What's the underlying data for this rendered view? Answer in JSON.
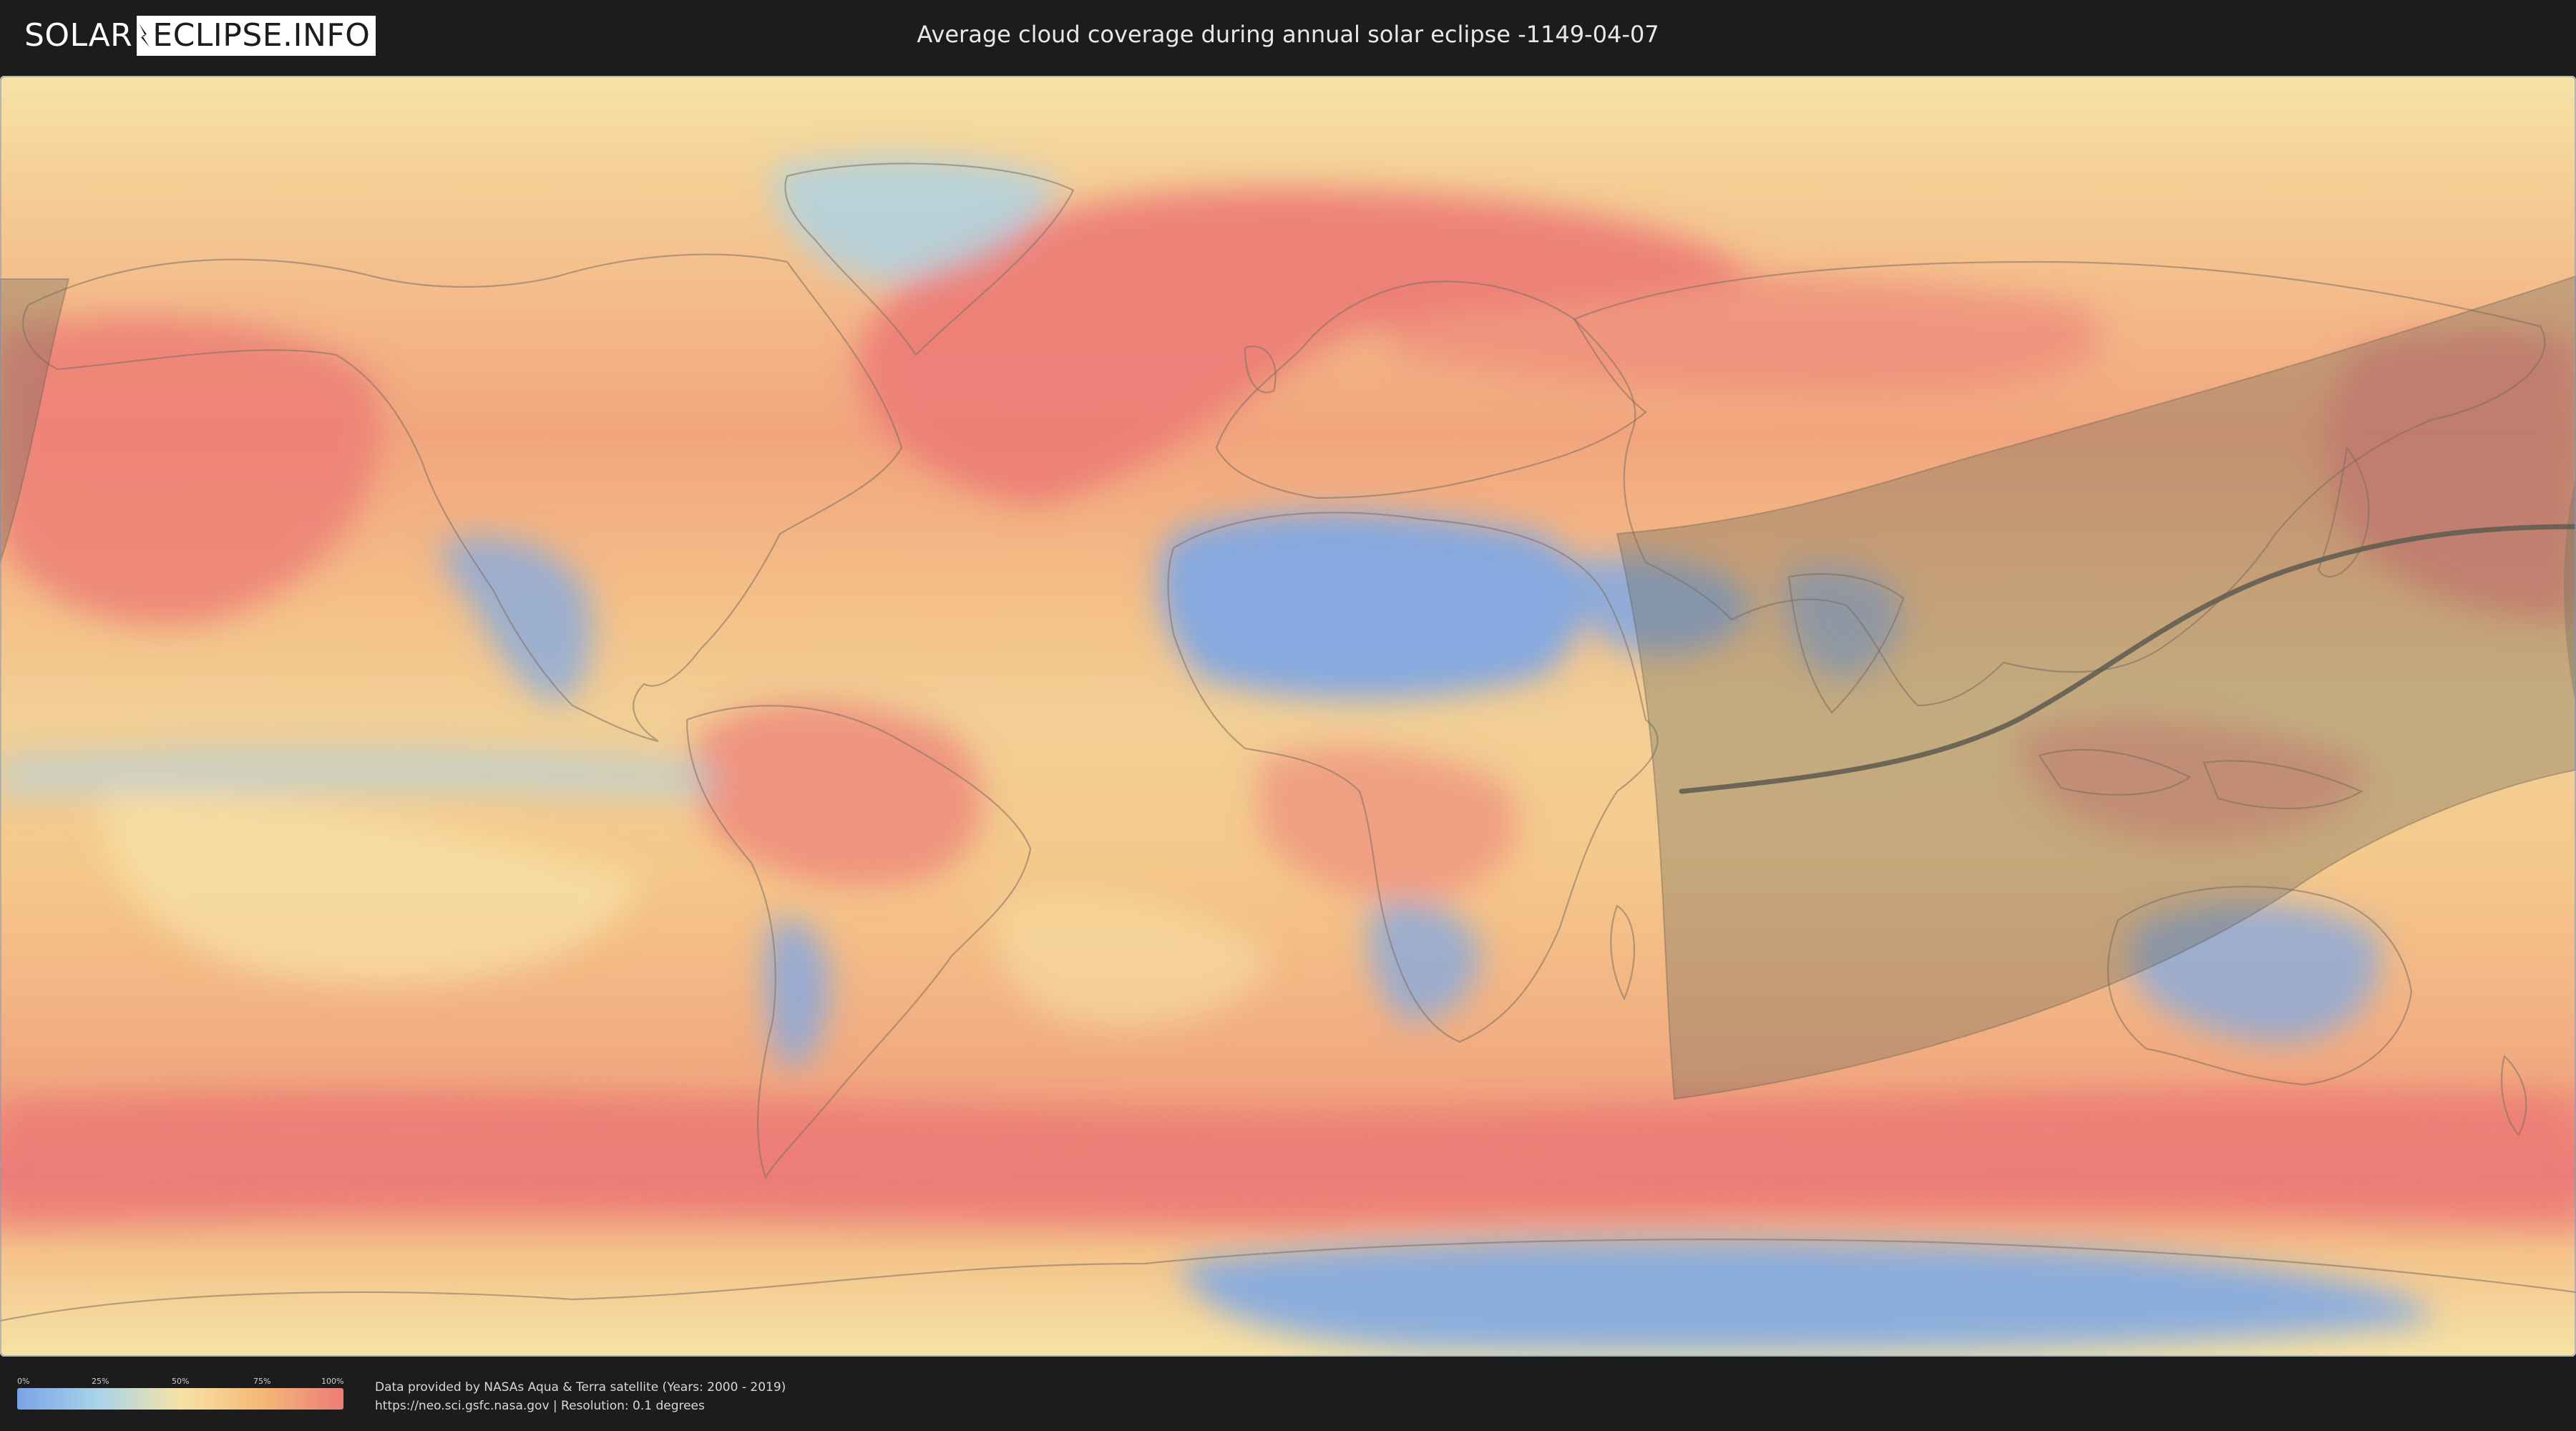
{
  "app": {
    "logo_left": "SOLAR",
    "logo_right": "ECLIPSE.INFO",
    "title": "Average cloud coverage during annual solar eclipse -1149-04-07"
  },
  "legend": {
    "ticks": [
      "0%",
      "25%",
      "50%",
      "75%",
      "100%"
    ],
    "colors": [
      "#7aa3e6",
      "#a9d3e9",
      "#f6e3a6",
      "#f5b877",
      "#ec7c77"
    ]
  },
  "credits": {
    "line1": "Data provided by NASAs Aqua & Terra satellite (Years: 2000 - 2019)",
    "line2": "https://neo.sci.gsfc.nasa.gov | Resolution: 0.1 degrees"
  },
  "map": {
    "colors": {
      "ocean_base": "#f3c78d",
      "high_cloud": "#ec7c77",
      "medium_cloud": "#f5b877",
      "low_cloud": "#f6e3a6",
      "clear": "#7fa8e4",
      "eclipse_shadow": "#6e6a5c",
      "central_line": "#5e5a50"
    }
  }
}
